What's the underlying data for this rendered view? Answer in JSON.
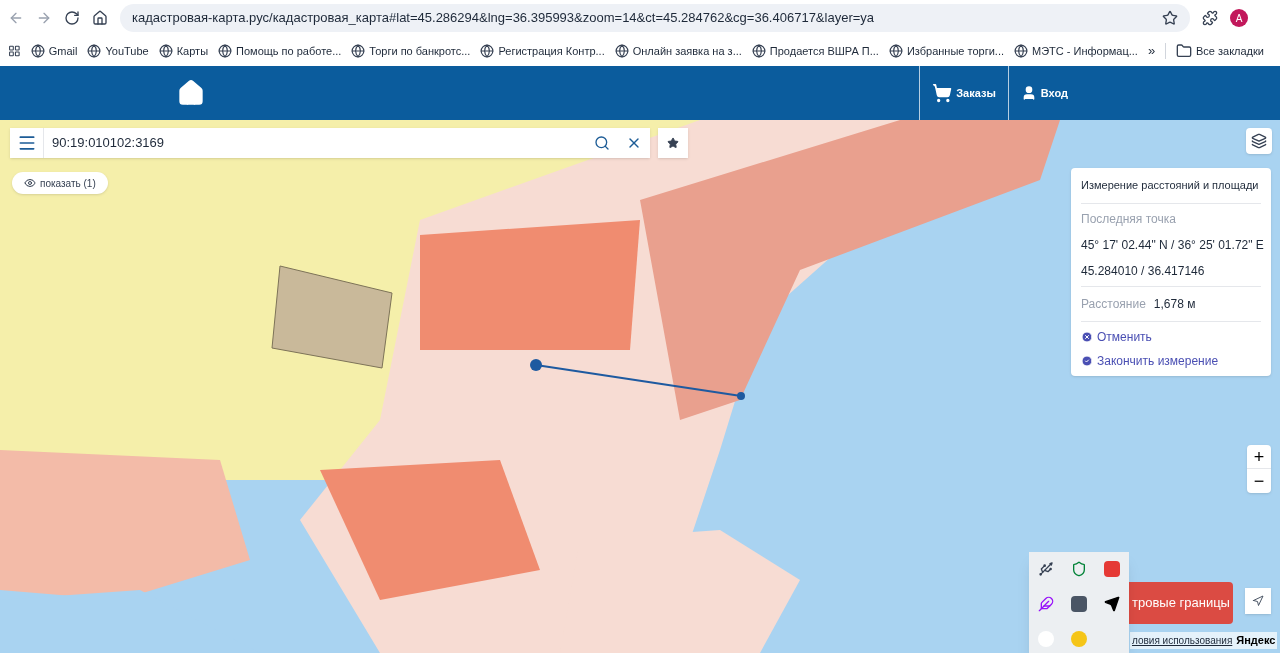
{
  "browser": {
    "url": "кадастровая-карта.рус/кадастровая_карта#lat=45.286294&lng=36.395993&zoom=14&ct=45.284762&cg=36.406717&layer=ya",
    "profile": "A",
    "bookmarks": [
      "Gmail",
      "YouTube",
      "Карты",
      "Помощь по работе...",
      "Торги по банкротс...",
      "Регистрация Контр...",
      "Онлайн заявка на з...",
      "Продается ВШРА П...",
      "Избранные торги...",
      "МЭТС - Информац..."
    ],
    "more": "»",
    "all_bookmarks": "Все закладки"
  },
  "header": {
    "nav": [
      {
        "kind": "cart",
        "label": "Заказы"
      },
      {
        "kind": "user",
        "label": "Вход"
      }
    ]
  },
  "search": {
    "value": "90:19:010102:3169"
  },
  "show_button": "показать (1)",
  "measure_panel": {
    "title": "Измерение расстояний и площади",
    "last_point_label": "Последняя точка",
    "coords_dms": "45° 17' 02.44\" N / 36° 25' 01.72\" E",
    "coords_decimal": "45.284010 / 36.417146",
    "distance_label": "Расстояние",
    "distance_value": "1,678 м",
    "actions": [
      {
        "kind": "cancel",
        "label": "Отменить"
      },
      {
        "kind": "finish",
        "label": "Закончить измерение"
      }
    ]
  },
  "zoom": {
    "plus": "+",
    "minus": "−"
  },
  "cadastral_button": "тровые границы",
  "footer": {
    "terms": "ловия использования",
    "brand": "Яндекс"
  }
}
